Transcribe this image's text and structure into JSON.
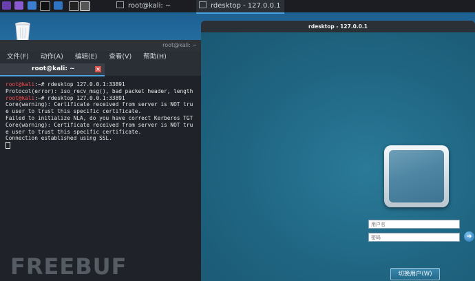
{
  "taskbar": {
    "tasks": [
      {
        "label": "root@kali: ~"
      },
      {
        "label": "rdesktop - 127.0.0.1"
      }
    ]
  },
  "terminal": {
    "title": "root@kali: ~",
    "menu": [
      "文件(F)",
      "动作(A)",
      "编辑(E)",
      "查看(V)",
      "帮助(H)"
    ],
    "tab_label": "root@kali: ~",
    "lines": [
      {
        "prompt": "root@kali",
        "text": ":~# rdesktop 127.0.0.1:33891"
      },
      {
        "text": "Protocol(error): iso_recv_msg(), bad packet header, length"
      },
      {
        "prompt": "root@kali",
        "text": ":~# rdesktop 127.0.0.1:33891"
      },
      {
        "text": "Core(warning): Certificate received from server is NOT tru"
      },
      {
        "text": "e user to trust this specific certificate."
      },
      {
        "text": "Failed to initialize NLA, do you have correct Kerberos TGT"
      },
      {
        "text": "Core(warning): Certificate received from server is NOT tru"
      },
      {
        "text": "e user to trust this specific certificate."
      },
      {
        "text": "Connection established using SSL."
      }
    ]
  },
  "watermark": "FREEBUF",
  "rdesktop": {
    "title": "rdesktop - 127.0.0.1",
    "username_placeholder": "用户名",
    "password_placeholder": "密码",
    "switch_user_label": "切换用户(W)"
  },
  "colors": {
    "accent": "#4aa3df",
    "prompt": "#ff4b4b",
    "rdp_bg": "#1f6582"
  }
}
